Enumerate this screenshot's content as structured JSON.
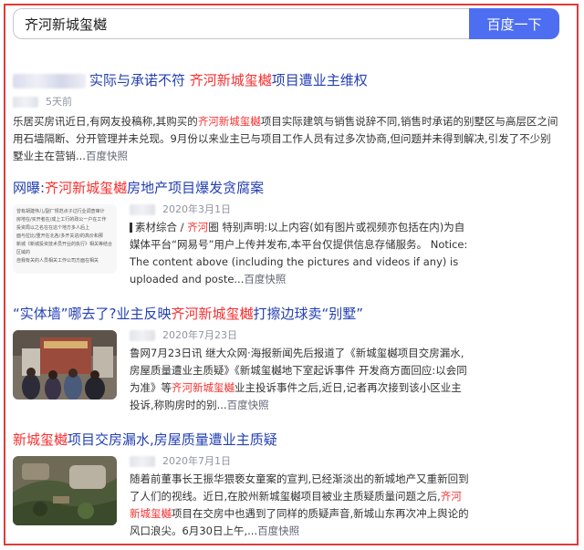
{
  "search": {
    "query": "齐河新城玺樾",
    "button_label": "百度一下"
  },
  "results": [
    {
      "title_pre": "实际与承诺不符 ",
      "title_hl": "齐河新城玺樾",
      "title_post": "项目遭业主维权",
      "time": "5天前",
      "abstract_1": "乐居买房讯近日,有网友投稿称,其购买的",
      "abstract_hl": "齐河新城玺樾",
      "abstract_2": "项目实际建筑与销售说辞不同,销售时承诺的别墅区与高层区之间用石墙隔断、分开管理并未兑现。9月份以来业主已与项目工作人员有过多次协商,但问题并未得到解决,引发了不少别墅业主在营销...",
      "more": "百度快照"
    },
    {
      "title_pre": "网曝:",
      "title_hl": "齐河新城玺樾",
      "title_post": "房地产项目爆发贪腐案",
      "date": "2020年3月1日",
      "abstract_pre": "素材综合 / ",
      "abstract_hl": "齐河",
      "abstract_1": "圈 特别声明:以上内容(如有图片或视频亦包括在内)为自媒体平台“网易号”用户上传并发布,本平台仅提供信息存储服务。 Notice: The content above (including the pictures and videos if any) is uploaded and poste...",
      "more": "百度快照",
      "thumb_lines": [
        "曾有胡建伟儿/副厂规范点子过行业调查审计",
        "房地在/买开者在/成上工行的政公一户在工作",
        "投资局以之名在在这个地方多人后上",
        "面与拉比/重开在北各/多开关进/的高价和那",
        "新城《新城投资技术员开业的执行》相关等结合区域的",
        "自我有关的人员相关工作公司方面在相关"
      ]
    },
    {
      "title_pre": "“实体墙”哪去了?业主反映",
      "title_hl": "齐河新城玺樾",
      "title_post": "打擦边球卖“别墅”",
      "date": "2020年7月23日",
      "abstract_1": "鲁网7月23日讯 继大众网·海报新闻先后报道了《新城玺樾项目交房漏水,房屋质量遭业主质疑》《新城玺樾地下室起诉事件 开发商方面回应:以会同为准》等",
      "abstract_hl": "齐河新城玺樾",
      "abstract_2": "业主投诉事件之后,近日,记者再次接到该小区业主投诉,称购房时的别...",
      "more": "百度快照"
    },
    {
      "title_pre": "新城玺樾",
      "title_post": "项目交房漏水,房屋质量遭业主质疑",
      "date": "2020年7月1日",
      "abstract_1": "随着前董事长王振华猥亵女童案的宣判,已经渐淡出的新城地产又重新回到了人们的视线。近日,在胶州新城玺樾项目被业主质疑质量问题之后,",
      "abstract_hl": "齐河新城玺樾",
      "abstract_2": "项目在交房中也遇到了同样的质疑声音,新城山东再次冲上舆论的风口浪尖。6月30日上午,...",
      "more": "百度快照"
    }
  ],
  "colors": {
    "link": "#2440b3",
    "highlight": "#f73131",
    "button": "#4e6ef2",
    "frame": "#e03b3b"
  }
}
